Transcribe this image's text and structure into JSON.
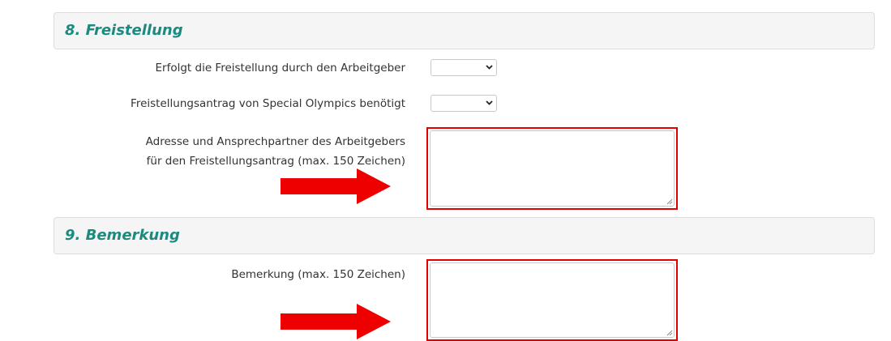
{
  "sections": [
    {
      "title": "8. Freistellung",
      "fields": [
        {
          "label": "Erfolgt die Freistellung durch den Arbeitgeber",
          "type": "select",
          "value": ""
        },
        {
          "label": "Freistellungsantrag von Special Olympics benötigt",
          "type": "select",
          "value": ""
        },
        {
          "label_lines": [
            "Adresse und Ansprechpartner des Arbeitgebers",
            "für den Freistellungsantrag (max. 150 Zeichen)"
          ],
          "type": "textarea",
          "value": ""
        }
      ]
    },
    {
      "title": "9. Bemerkung",
      "fields": [
        {
          "label": "Bemerkung (max. 150 Zeichen)",
          "type": "textarea",
          "value": ""
        }
      ]
    }
  ],
  "colors": {
    "accent": "#1b8a7f",
    "highlight": "#e50000",
    "arrow": "#ee0000",
    "header_bg": "#f5f5f5"
  },
  "icons": {
    "select_caret": "chevron-down-icon",
    "resize": "resize-grip-icon",
    "annotation": "arrow-right-icon"
  }
}
